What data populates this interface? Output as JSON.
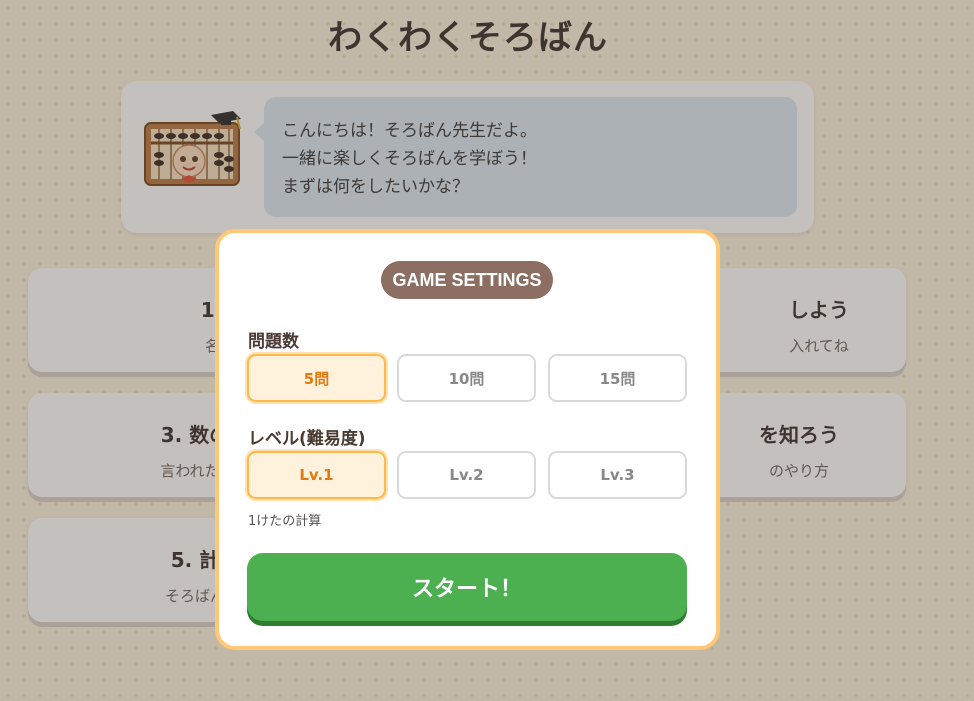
{
  "app": {
    "title": "わくわくそろばん"
  },
  "intro": {
    "lines": [
      "こんにちは！そろばん先生だよ。",
      "一緒に楽しくそろばんを学ぼう！",
      "まずは何をしたいかな？"
    ]
  },
  "menu": [
    {
      "title": "1. そろ",
      "sub": "名前や役"
    },
    {
      "title": "しよう",
      "sub": "入れてね"
    },
    {
      "title": "3. 数の入",
      "sub": "言われた数を"
    },
    {
      "title": "を知ろう",
      "sub": "のやり方"
    },
    {
      "title": "5. 計",
      "sub": "そろばん"
    }
  ],
  "modal": {
    "badge": "GAME SETTINGS",
    "count_label": "問題数",
    "count_options": [
      "5問",
      "10問",
      "15問"
    ],
    "count_selected": "5問",
    "level_label": "レベル(難易度)",
    "level_options": [
      "Lv.1",
      "Lv.2",
      "Lv.3"
    ],
    "level_selected": "Lv.1",
    "level_description": "1けたの計算",
    "start_label": "スタート！"
  },
  "colors": {
    "accent": "#ffb84a",
    "badge": "#8d6e63",
    "start": "#4caf50",
    "bubble": "#dbe9f4"
  },
  "icons": {
    "mascot": "abacus-teacher-icon"
  }
}
